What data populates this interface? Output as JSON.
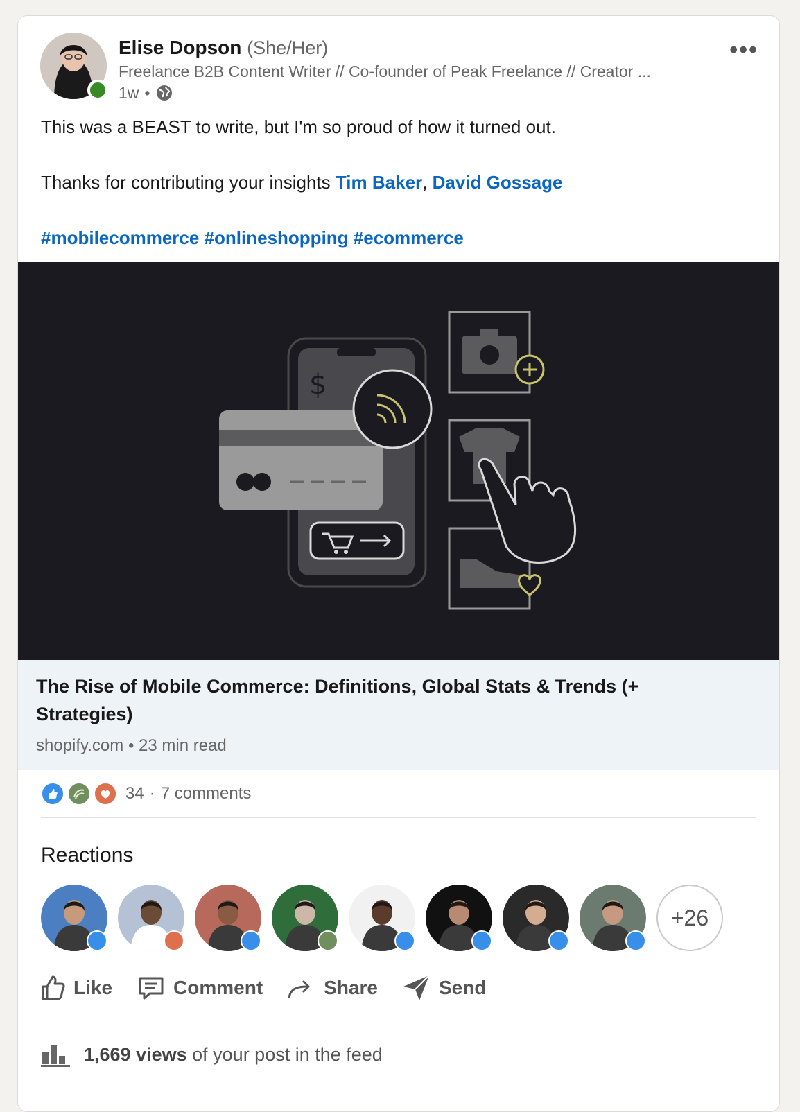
{
  "post": {
    "author_name": "Elise Dopson",
    "pronouns": "(She/Her)",
    "headline": "Freelance B2B Content Writer // Co-founder of Peak Freelance // Creator ...",
    "time": "1w",
    "more_label": "•••",
    "line1": "This was a BEAST to write, but I'm so proud of how it turned out.",
    "line2_prefix": "Thanks for contributing your insights",
    "mention1": "Tim Baker",
    "mention_sep": ",",
    "mention2": "David Gossage",
    "hashtags": [
      "#mobilecommerce",
      "#onlineshopping",
      "#ecommerce"
    ]
  },
  "article": {
    "title": "The Rise of Mobile Commerce: Definitions, Global Stats & Trends (+ Strategies)",
    "source": "shopify.com",
    "read_time": "23 min read"
  },
  "social": {
    "reaction_count": "34",
    "comments": "7 comments"
  },
  "reactions": {
    "title": "Reactions",
    "more_count": "+26",
    "people": [
      {
        "badge": "like"
      },
      {
        "badge": "love"
      },
      {
        "badge": "like"
      },
      {
        "badge": "support"
      },
      {
        "badge": "like"
      },
      {
        "badge": "like"
      },
      {
        "badge": "like"
      },
      {
        "badge": "like"
      }
    ]
  },
  "actions": {
    "like": "Like",
    "comment": "Comment",
    "share": "Share",
    "send": "Send"
  },
  "views": {
    "count": "1,669 views",
    "suffix": "of your post in the feed"
  },
  "colors": {
    "link": "#0a66c2",
    "media_bg": "#1b1a20",
    "like_badge": "#378fe9",
    "love_badge": "#df704d",
    "presence": "#378a26"
  }
}
